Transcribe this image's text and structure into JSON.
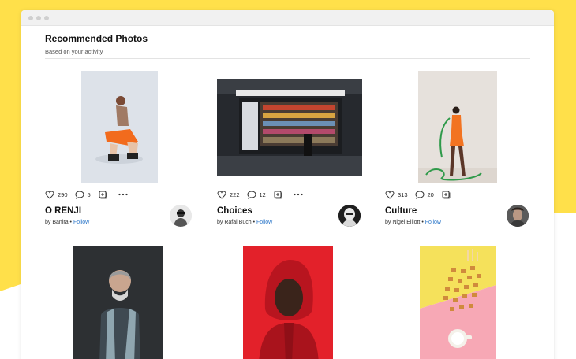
{
  "section": {
    "title": "Recommended Photos",
    "subtitle": "Based on your activity"
  },
  "colors": {
    "background_accent": "#FFE04A",
    "link": "#2A76C9"
  },
  "photos": [
    {
      "title": "O RENJI",
      "by_prefix": "by",
      "author": "Banira",
      "separator": "•",
      "follow": "Follow",
      "likes": "290",
      "comments": "5"
    },
    {
      "title": "Choices",
      "by_prefix": "by",
      "author": "Rafal Buch",
      "separator": "•",
      "follow": "Follow",
      "likes": "222",
      "comments": "12"
    },
    {
      "title": "Culture",
      "by_prefix": "by",
      "author": "Nigel Elliott",
      "separator": "•",
      "follow": "Follow",
      "likes": "313",
      "comments": "20"
    }
  ],
  "icons": {
    "like": "heart-icon",
    "comment": "speech-bubble-icon",
    "save": "add-to-collection-icon",
    "more": "more-options-icon"
  }
}
